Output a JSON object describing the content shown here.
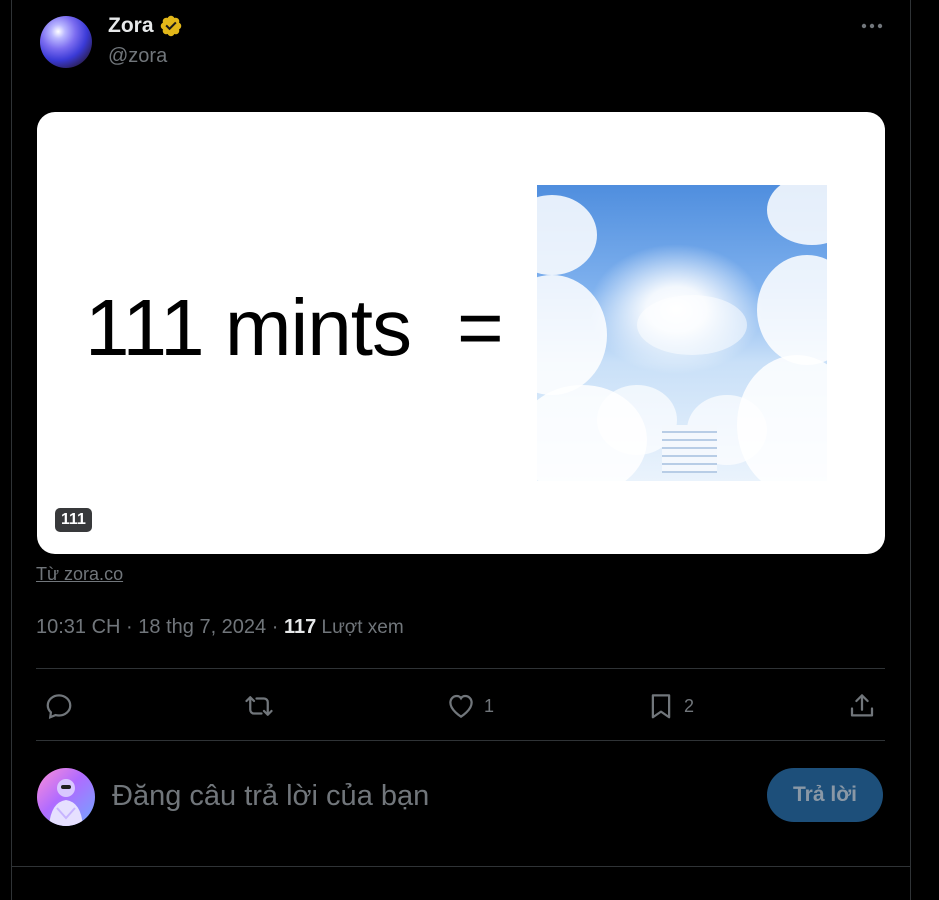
{
  "tweet": {
    "author_name": "Zora",
    "author_handle": "@zora",
    "verified_icon": "verified-badge-icon",
    "more_icon": "more-options-icon"
  },
  "card": {
    "headline": "111 mints",
    "equals": "=",
    "badge": "111",
    "image_alt": "heaven clouds stairway"
  },
  "source": {
    "label": "Từ zora.co"
  },
  "meta": {
    "time": "10:31 CH",
    "separator1": " · ",
    "date": "18 thg 7, 2024",
    "separator2": " · ",
    "views_count": "117",
    "views_label": " Lượt xem"
  },
  "actions": {
    "reply_icon": "reply-icon",
    "retweet_icon": "retweet-icon",
    "like_icon": "heart-icon",
    "like_count": "1",
    "bookmark_icon": "bookmark-icon",
    "bookmark_count": "2",
    "share_icon": "share-icon"
  },
  "composer": {
    "placeholder": "Đăng câu trả lời của bạn",
    "reply_button": "Trả lời"
  },
  "colors": {
    "background": "#000000",
    "text_primary": "#e7e9ea",
    "text_secondary": "#71767b",
    "divider": "#2f3336",
    "verified_gold": "#e2b719",
    "reply_button_bg": "#1d4f7a"
  }
}
